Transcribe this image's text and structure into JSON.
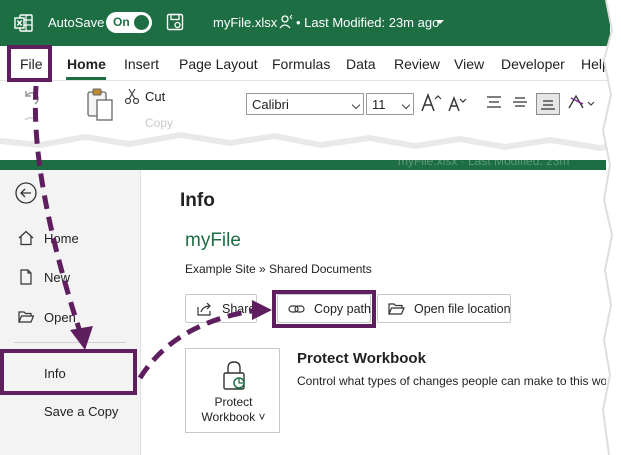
{
  "titlebar": {
    "autosave_label": "AutoSave",
    "autosave_state": "On",
    "file_name": "myFile.xlsx",
    "last_modified": "• Last Modified: 23m ago",
    "brand_color": "#1e6e43"
  },
  "tabs": [
    "File",
    "Home",
    "Insert",
    "Page Layout",
    "Formulas",
    "Data",
    "Review",
    "View",
    "Developer",
    "Help"
  ],
  "ribbon": {
    "cut_label": "Cut",
    "copy_label": "Copy",
    "font_name": "Calibri",
    "font_size": "11"
  },
  "backstage": {
    "ghost_title": "myFile.xlsx  ·  Last Modified: 23m",
    "nav": {
      "home": "Home",
      "new": "New",
      "open": "Open",
      "info": "Info",
      "save_copy": "Save a Copy"
    },
    "info_heading": "Info",
    "doc_title": "myFile",
    "doc_path": "Example Site » Shared Documents",
    "buttons": {
      "share": "Share",
      "copy_path": "Copy path",
      "open_location": "Open file location"
    },
    "protect": {
      "tile_line1": "Protect",
      "tile_line2": "Workbook ˅",
      "heading": "Protect Workbook",
      "description": "Control what types of changes people can make to this wo"
    }
  },
  "highlight_color": "#5f1f5f",
  "icons": [
    "excel-logo-icon",
    "save-icon",
    "person-icon",
    "undo-icon",
    "paste-icon",
    "scissors-icon",
    "grow-font-icon",
    "shrink-font-icon",
    "align-icon",
    "orientation-icon",
    "back-arrow-icon",
    "home-icon",
    "new-document-icon",
    "open-folder-icon",
    "share-icon",
    "link-icon",
    "folder-icon",
    "lock-icon"
  ]
}
